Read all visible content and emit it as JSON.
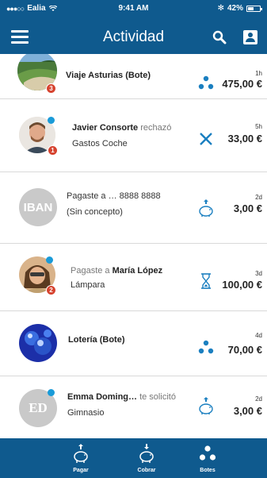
{
  "status_bar": {
    "carrier": "Ealia",
    "time": "9:41 AM",
    "battery": "42%"
  },
  "header": {
    "title": "Actividad"
  },
  "activities": [
    {
      "avatar_type": "photo-landscape",
      "badge": "3",
      "unread": false,
      "line1_strong": "Viaje Asturias (Bote)",
      "line1_light": "",
      "line2": "",
      "time": "1h",
      "amount": "475,00 €",
      "type_icon": "bote-dots-icon"
    },
    {
      "avatar_type": "photo-man",
      "badge": "1",
      "unread": true,
      "line1_strong": "Javier Consorte",
      "line1_light": "rechazó",
      "line2": "Gastos Coche",
      "time": "5h",
      "amount": "33,00 €",
      "type_icon": "rejected-x-icon"
    },
    {
      "avatar_type": "text",
      "avatar_text": "IBAN",
      "badge": "",
      "unread": false,
      "line1_strong": "",
      "line1_light": "Pagaste a … 8888 8888",
      "line2": "(Sin concepto)",
      "time": "2d",
      "amount": "3,00 €",
      "type_icon": "pay-piggy-icon"
    },
    {
      "avatar_type": "photo-woman",
      "badge": "2",
      "unread": true,
      "line1_light": "Pagaste a",
      "line1_strong": "María López",
      "line2": "Lámpara",
      "time": "3d",
      "amount": "100,00 €",
      "type_icon": "pending-hourglass-icon"
    },
    {
      "avatar_type": "photo-lottery",
      "badge": "",
      "unread": false,
      "line1_strong": "Lotería (Bote)",
      "line1_light": "",
      "line2": "",
      "time": "4d",
      "amount": "70,00 €",
      "type_icon": "bote-dots-icon"
    },
    {
      "avatar_type": "text",
      "avatar_text": "ED",
      "badge": "",
      "unread": true,
      "line1_strong": "Emma Doming…",
      "line1_light": "te solicitó",
      "line2": "Gimnasio",
      "time": "2d",
      "amount": "3,00 €",
      "type_icon": "pay-piggy-icon"
    }
  ],
  "tabbar": {
    "tabs": [
      {
        "label": "Pagar",
        "icon": "pay-piggy-icon"
      },
      {
        "label": "Cobrar",
        "icon": "charge-piggy-icon"
      },
      {
        "label": "Botes",
        "icon": "botes-dots-icon"
      }
    ]
  },
  "colors": {
    "primary": "#0f5a8e",
    "accent_icon": "#1a7fc0",
    "badge": "#d6432f",
    "unread": "#1a9bd8"
  }
}
